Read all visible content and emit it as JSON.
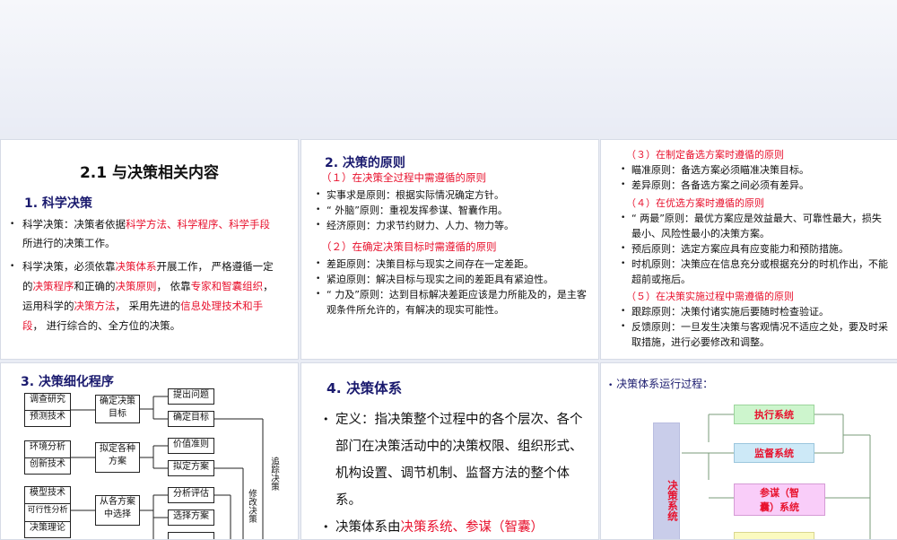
{
  "slide1": {
    "title": "2.1  与决策相关内容",
    "section": "1.  科学决策",
    "b1": [
      {
        "t": "科学决策：决策者依据",
        "c": "k"
      },
      {
        "t": "科学方法、科学程序、科学手段",
        "c": "r"
      },
      {
        "t": "所进行的决策工作。",
        "c": "k"
      }
    ],
    "b2": [
      {
        "t": "科学决策，必须依靠",
        "c": "k"
      },
      {
        "t": "决策体系",
        "c": "r"
      },
      {
        "t": "开展工作， 严格遵循一定的",
        "c": "k"
      },
      {
        "t": "决策程序",
        "c": "r"
      },
      {
        "t": "和正确的",
        "c": "k"
      },
      {
        "t": "决策原则",
        "c": "r"
      },
      {
        "t": "， 依靠",
        "c": "k"
      },
      {
        "t": "专家和智囊组织",
        "c": "r"
      },
      {
        "t": "， 运用科学的",
        "c": "k"
      },
      {
        "t": "决策方法",
        "c": "r"
      },
      {
        "t": "， 采用先进的",
        "c": "k"
      },
      {
        "t": "信息处理技术和手段",
        "c": "r"
      },
      {
        "t": "， 进行综合的、全方位的决策。",
        "c": "k"
      }
    ]
  },
  "slide2": {
    "title": "2.  决策的原则",
    "sub1": "（１）在决策全过程中需遵循的原则",
    "items1": [
      "实事求是原则：根据实际情况确定方针。",
      "“ 外脑”原则：重视发挥参谋、智囊作用。",
      "经济原则：力求节约财力、人力、物力等。"
    ],
    "sub2": "（２）在确定决策目标时需遵循的原则",
    "items2": [
      "差距原则：决策目标与现实之间存在一定差距。",
      "紧迫原则：解决目标与现实之间的差距具有紧迫性。",
      "“ 力及”原则：达到目标解决差距应该是力所能及的，是主客观条件所允许的，有解决的现实可能性。"
    ]
  },
  "slide3": {
    "sub3": "（３）在制定备选方案时遵循的原则",
    "items3": [
      "瞄准原则：备选方案必须瞄准决策目标。",
      "差异原则：各备选方案之间必须有差异。"
    ],
    "sub4": "（４）在优选方案时遵循的原则",
    "items4": [
      "“ 两最”原则：最优方案应是效益最大、可靠性最大，损失最小、风险性最小的决策方案。",
      "预后原则：选定方案应具有应变能力和预防措施。",
      "时机原则：决策应在信息充分或根据充分的时机作出，不能超前或拖后。"
    ],
    "sub5": "（５）在决策实施过程中需遵循的原则",
    "items5": [
      "跟踪原则：决策付诸实施后要随时检查验证。",
      "反馈原则：一旦发生决策与客观情况不适应之处，要及时采取措施，进行必要修改和调整。"
    ]
  },
  "slide4": {
    "title": "3.  决策细化程序",
    "left": [
      "调查研究",
      "预测技术",
      "环境分析",
      "创新技术",
      "模型技术",
      "可行性分析",
      "决策理论"
    ],
    "mid": [
      "确定决策目标",
      "拟定各种方案",
      "从各方案中选择"
    ],
    "right": [
      "提出问题",
      "确定目标",
      "价值准则",
      "拟定方案",
      "分析评估",
      "选择方案"
    ],
    "side1": "追踪决策",
    "side2": "修改决策"
  },
  "slide5": {
    "title": "4.  决策体系",
    "def": "定义：指决策整个过程中的各个层次、各个部门在决策活动中的决策权限、组织形式、机构设置、调节机制、监督方法的整个体系。",
    "p2a": "决策体系由",
    "p2b": "决策系统、参谋（智囊）"
  },
  "slide6": {
    "title": "决策体系运行过程：",
    "decision": "决策系统",
    "exec": "执行系统",
    "monitor": "监督系统",
    "staff": "参谋（智囊）系统"
  }
}
